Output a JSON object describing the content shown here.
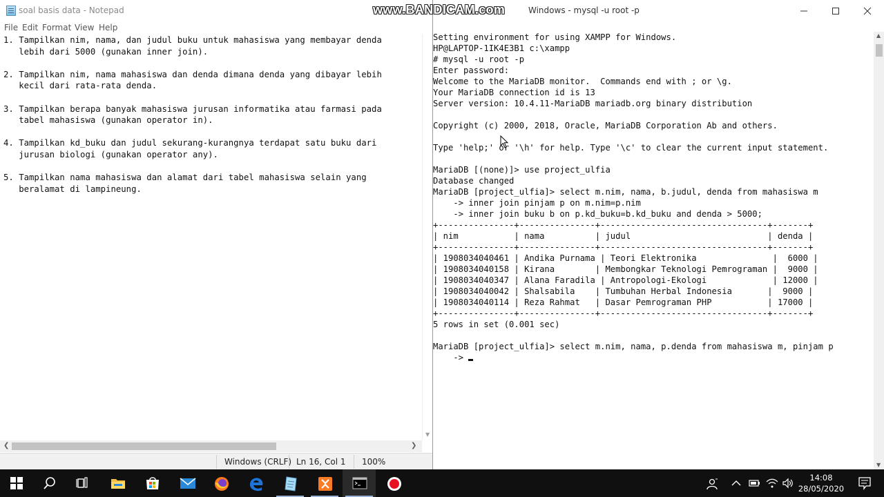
{
  "notepad": {
    "title": "soal basis data - Notepad",
    "menu": [
      "File",
      "Edit",
      "Format",
      "View",
      "Help"
    ],
    "lines": [
      "1. Tampilkan nim, nama, dan judul buku untuk mahasiswa yang membayar denda",
      "   lebih dari 5000 (gunakan inner join).",
      "",
      "2. Tampilkan nim, nama mahasiswa dan denda dimana denda yang dibayar lebih",
      "   kecil dari rata-rata denda.",
      "",
      "3. Tampilkan berapa banyak mahasiswa jurusan informatika atau farmasi pada",
      "   tabel mahasiswa (gunakan operator in).",
      "",
      "4. Tampilkan kd_buku dan judul sekurang-kurangnya terdapat satu buku dari",
      "   jurusan biologi (gunakan operator any).",
      "",
      "5. Tampilkan nama mahasiswa dan alamat dari tabel mahasiswa selain yang",
      "   beralamat di lampineung."
    ],
    "status": {
      "encoding": "Windows (CRLF)",
      "position": "Ln 16, Col 1",
      "zoom": "100%"
    }
  },
  "console": {
    "title": "Windows - mysql  -u root -p",
    "watermark": "www.BANDICAM.com",
    "lines": [
      "Setting environment for using XAMPP for Windows.",
      "HP@LAPTOP-1IK4E3B1 c:\\xampp",
      "# mysql -u root -p",
      "Enter password:",
      "Welcome to the MariaDB monitor.  Commands end with ; or \\g.",
      "Your MariaDB connection id is 13",
      "Server version: 10.4.11-MariaDB mariadb.org binary distribution",
      "",
      "Copyright (c) 2000, 2018, Oracle, MariaDB Corporation Ab and others.",
      "",
      "Type 'help;' or '\\h' for help. Type '\\c' to clear the current input statement.",
      "",
      "MariaDB [(none)]> use project_ulfia",
      "Database changed",
      "MariaDB [project_ulfia]> select m.nim, nama, b.judul, denda from mahasiswa m",
      "    -> inner join pinjam p on m.nim=p.nim",
      "    -> inner join buku b on p.kd_buku=b.kd_buku and denda > 5000;",
      "+---------------+---------------+---------------------------------+-------+",
      "| nim           | nama          | judul                           | denda |",
      "+---------------+---------------+---------------------------------+-------+",
      "| 1908034040461 | Andika Purnama | Teori Elektronika               |  6000 |",
      "| 1908034040158 | Kirana        | Membongkar Teknologi Pemrograman |  9000 |",
      "| 1908034040347 | Alana Faradila | Antropologi-Ekologi             | 12000 |",
      "| 1908034040042 | Shalsabila    | Tumbuhan Herbal Indonesia       |  9000 |",
      "| 1908034040114 | Reza Rahmat   | Dasar Pemrograman PHP           | 17000 |",
      "+---------------+---------------+---------------------------------+-------+",
      "5 rows in set (0.001 sec)",
      "",
      "MariaDB [project_ulfia]> select m.nim, nama, p.denda from mahasiswa m, pinjam p",
      "    -> "
    ]
  },
  "taskbar": {
    "time": "14:08",
    "date": "28/05/2020",
    "apps": [
      "start-icon",
      "search-icon",
      "task-view-icon",
      "file-explorer-icon",
      "store-icon",
      "mail-icon",
      "firefox-icon",
      "edge-icon",
      "notepad-icon",
      "xampp-icon",
      "terminal-icon",
      "record-icon"
    ]
  },
  "colors": {
    "taskbar_bg": "#101010",
    "xampp_orange": "#fb7a24",
    "record_red": "#e81123",
    "edge_blue": "#1e73d6"
  }
}
